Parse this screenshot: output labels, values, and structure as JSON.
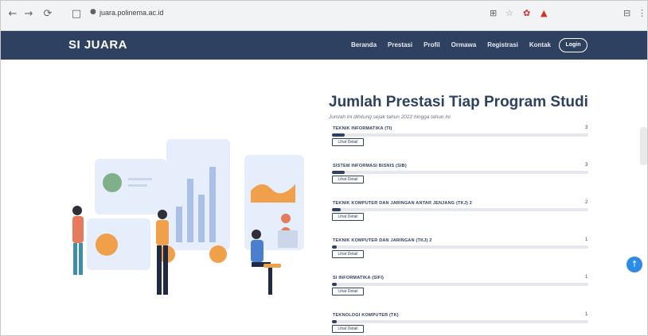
{
  "browser": {
    "url": "juara.polinema.ac.id",
    "nav": {
      "back": "←",
      "forward": "→",
      "reload": "⟳",
      "page_info": "🔒"
    },
    "extensions": [
      "⊞",
      "♡",
      "⊕",
      "▲",
      "⊟",
      "⋮"
    ]
  },
  "site": {
    "brand": "SI JUARA",
    "menu": [
      {
        "label": "Beranda"
      },
      {
        "label": "Prestasi"
      },
      {
        "label": "Profil"
      },
      {
        "label": "Ormawa"
      },
      {
        "label": "Registrasi"
      },
      {
        "label": "Kontak"
      }
    ],
    "login_label": "Login"
  },
  "panel": {
    "title": "Jumlah Prestasi Tiap Program Studi",
    "subtitle": "Jumlah ini dihitung sejak tahun 2022 hingga tahun ini",
    "detail_label": "Lihat Detail",
    "programs": [
      {
        "name": "TEKNIK INFORMATIKA (TI)",
        "count": "3",
        "fraction": 0.05
      },
      {
        "name": "SISTEM INFORMASI BISNIS (SIB)",
        "count": "3",
        "fraction": 0.05
      },
      {
        "name": "TEKNIK KOMPUTER DAN JARINGAN ANTAR JENJANG (TKJ) 2",
        "count": "2",
        "fraction": 0.035
      },
      {
        "name": "TEKNIK KOMPUTER DAN JARINGAN (TKJ) 2",
        "count": "1",
        "fraction": 0.02
      },
      {
        "name": "SI INFORMATIKA (SIFI)",
        "count": "1",
        "fraction": 0.02
      },
      {
        "name": "TEKNOLOGI KOMPUTER (TK)",
        "count": "1",
        "fraction": 0.02
      }
    ]
  },
  "colors": {
    "navy": "#2f4160",
    "accent_orange": "#f0a04b",
    "accent_blue": "#2b8be6"
  }
}
